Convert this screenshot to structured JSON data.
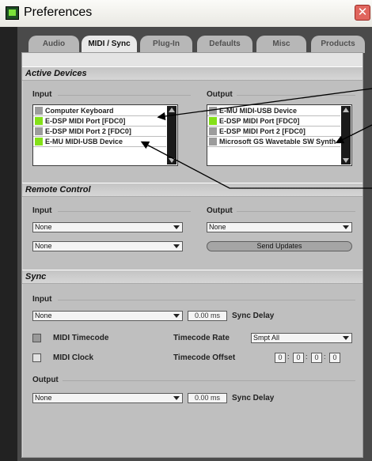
{
  "window": {
    "title": "Preferences",
    "close_icon": "close-icon"
  },
  "tabs": [
    {
      "label": "Audio"
    },
    {
      "label": "MIDI / Sync"
    },
    {
      "label": "Plug-In"
    },
    {
      "label": "Defaults"
    },
    {
      "label": "Misc"
    },
    {
      "label": "Products"
    }
  ],
  "active_devices": {
    "title": "Active Devices",
    "input_label": "Input",
    "output_label": "Output",
    "inputs": [
      {
        "name": "Computer Keyboard",
        "active": false
      },
      {
        "name": "E-DSP MIDI Port [FDC0]",
        "active": true
      },
      {
        "name": "E-DSP MIDI Port 2 [FDC0]",
        "active": false
      },
      {
        "name": "E-MU MIDI-USB Device",
        "active": true
      }
    ],
    "outputs": [
      {
        "name": "E-MU MIDI-USB Device",
        "active": false
      },
      {
        "name": "E-DSP MIDI Port [FDC0]",
        "active": true
      },
      {
        "name": "E-DSP MIDI Port 2 [FDC0]",
        "active": false
      },
      {
        "name": "Microsoft GS Wavetable SW Synth",
        "active": false
      }
    ]
  },
  "remote_control": {
    "title": "Remote Control",
    "input_label": "Input",
    "output_label": "Output",
    "input1": "None",
    "input2": "None",
    "output1": "None",
    "send_updates_label": "Send Updates"
  },
  "sync": {
    "title": "Sync",
    "input_label": "Input",
    "input_value": "None",
    "input_delay": "0.00 ms",
    "sync_delay_label": "Sync Delay",
    "midi_timecode_label": "MIDI Timecode",
    "midi_clock_label": "MIDI Clock",
    "timecode_rate_label": "Timecode Rate",
    "timecode_rate_value": "Smpt All",
    "timecode_offset_label": "Timecode Offset",
    "offset": [
      "0",
      "0",
      "0",
      "0"
    ],
    "output_label": "Output",
    "output_value": "None",
    "output_delay": "0.00 ms"
  },
  "colors": {
    "accent_green": "#84e018",
    "panel": "#e4e4e4",
    "frame": "#4a4a4a"
  }
}
